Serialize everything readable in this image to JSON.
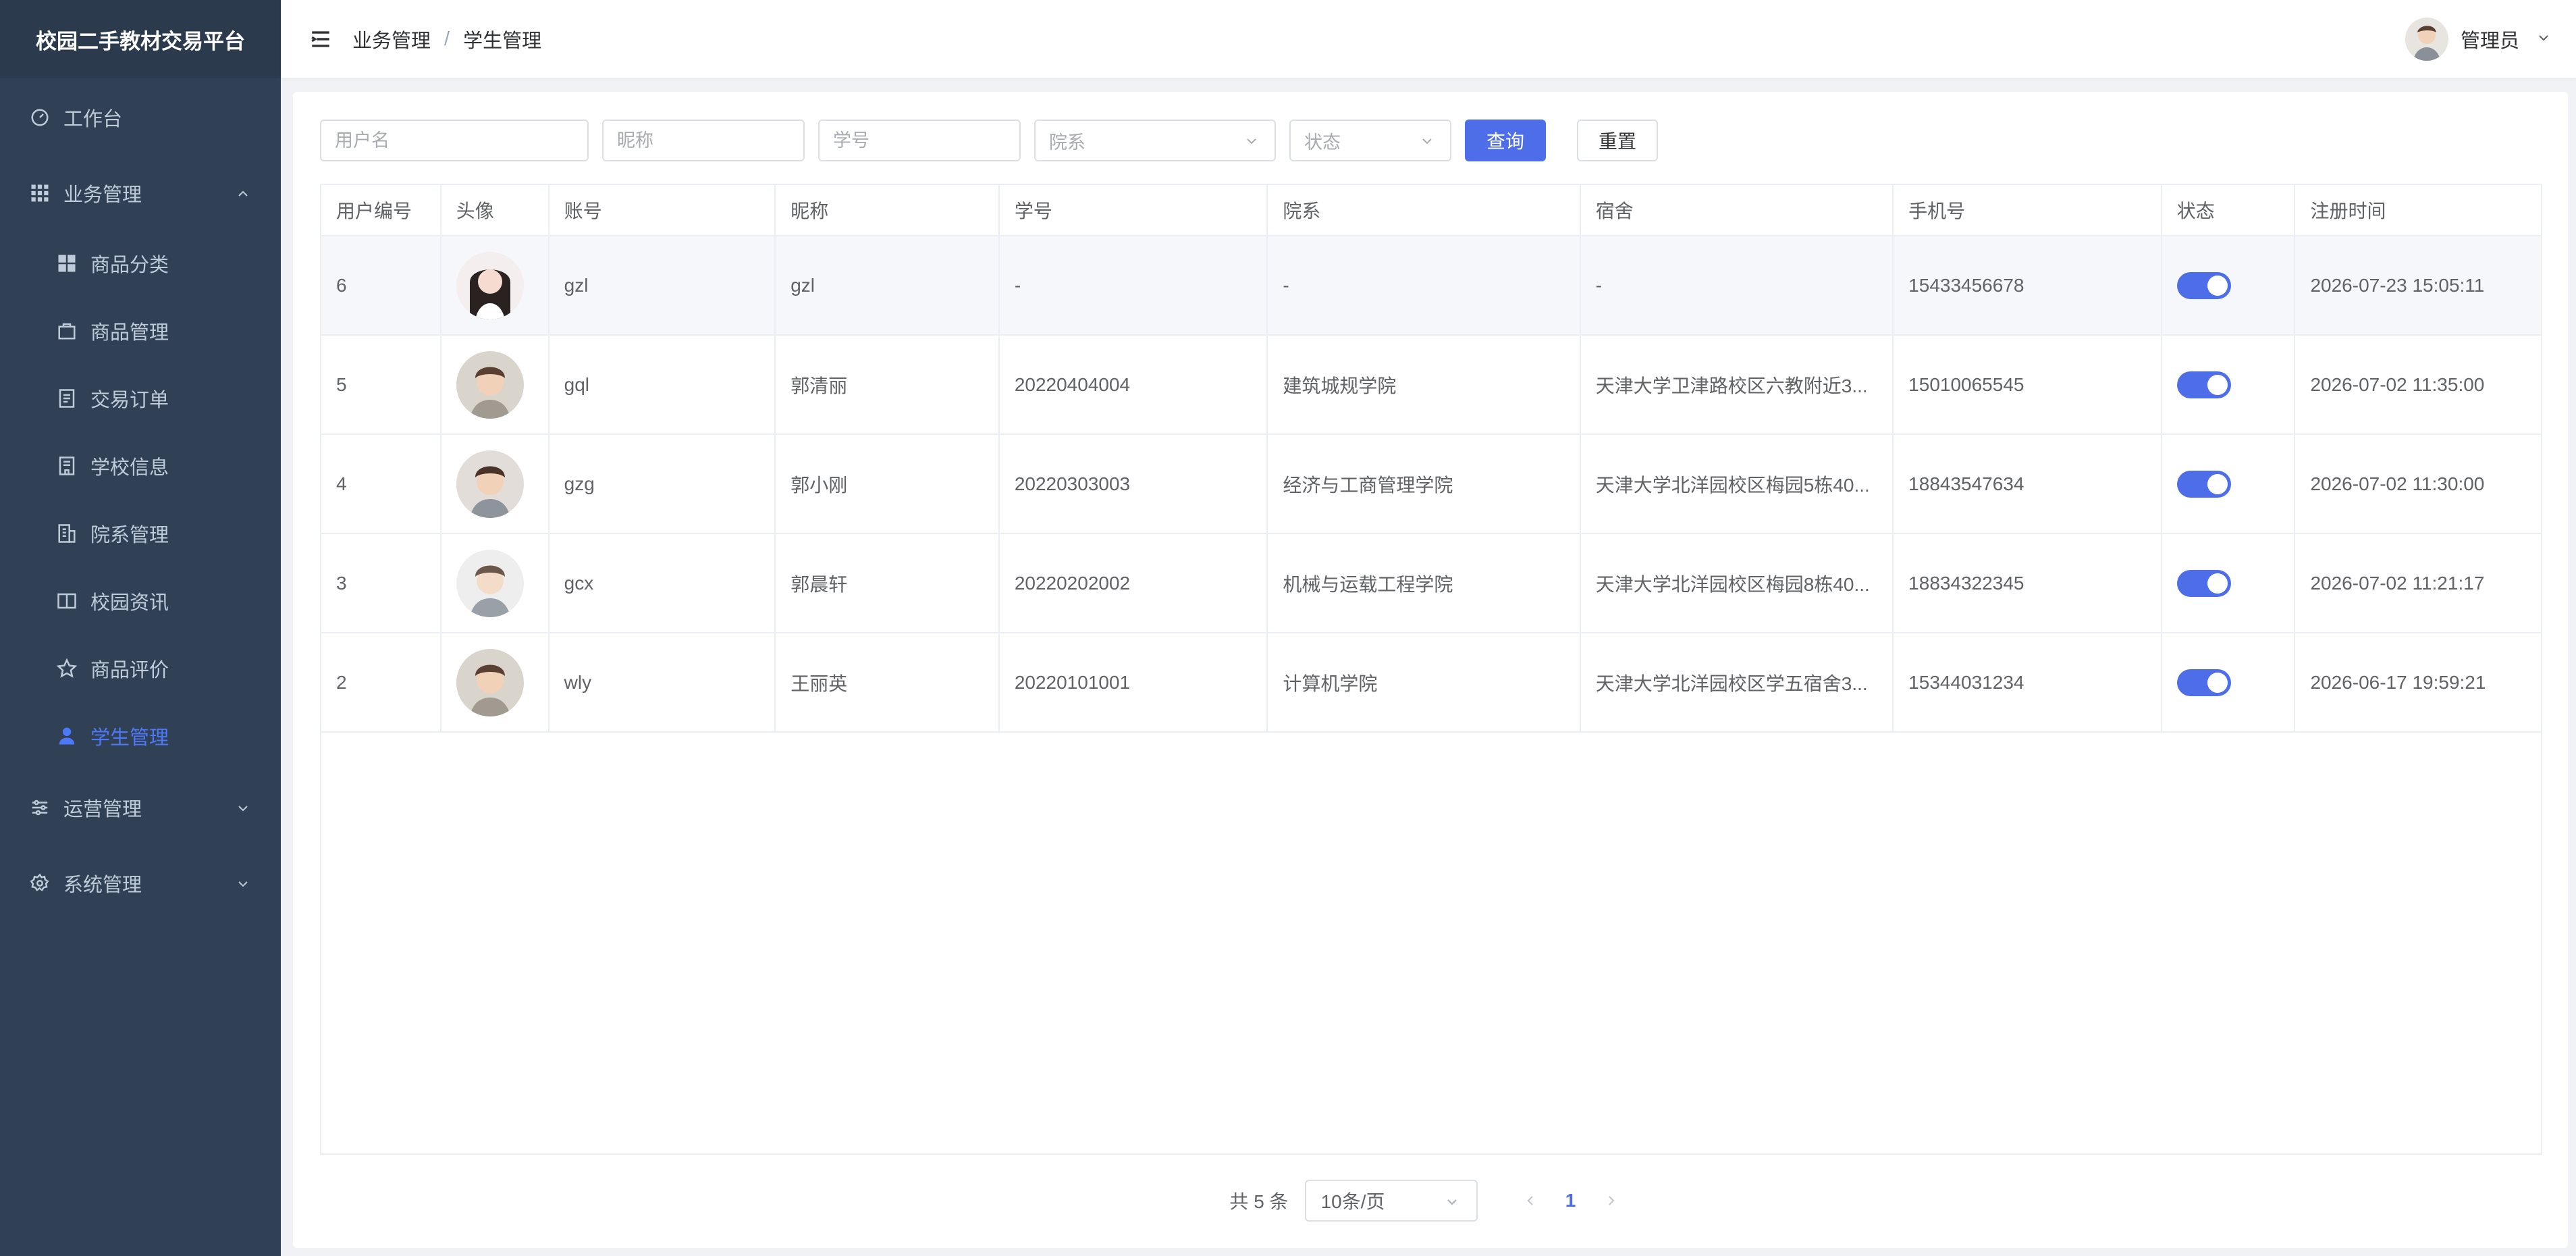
{
  "app_title": "校园二手教材交易平台",
  "sidebar": {
    "items": [
      {
        "label": "工作台",
        "icon": "dashboard-icon"
      },
      {
        "label": "业务管理",
        "icon": "grid-icon",
        "expanded": true
      },
      {
        "label": "商品分类",
        "icon": "category-icon"
      },
      {
        "label": "商品管理",
        "icon": "shopping-bag-icon"
      },
      {
        "label": "交易订单",
        "icon": "document-icon"
      },
      {
        "label": "学校信息",
        "icon": "school-icon"
      },
      {
        "label": "院系管理",
        "icon": "building-icon"
      },
      {
        "label": "校园资讯",
        "icon": "book-icon"
      },
      {
        "label": "商品评价",
        "icon": "star-icon"
      },
      {
        "label": "学生管理",
        "icon": "user-icon",
        "active": true
      },
      {
        "label": "运营管理",
        "icon": "sliders-icon"
      },
      {
        "label": "系统管理",
        "icon": "gear-icon"
      }
    ]
  },
  "header": {
    "breadcrumb": [
      "业务管理",
      "学生管理"
    ],
    "separator": "/",
    "user_name": "管理员"
  },
  "filters": {
    "username_placeholder": "用户名",
    "nickname_placeholder": "昵称",
    "student_no_placeholder": "学号",
    "department_placeholder": "院系",
    "status_placeholder": "状态",
    "query_label": "查询",
    "reset_label": "重置"
  },
  "table": {
    "columns": [
      "用户编号",
      "头像",
      "账号",
      "昵称",
      "学号",
      "院系",
      "宿舍",
      "手机号",
      "状态",
      "注册时间"
    ],
    "rows": [
      {
        "id": "6",
        "account": "gzl",
        "nickname": "gzl",
        "student_no": "-",
        "department": "-",
        "dorm": "-",
        "phone": "15433456678",
        "status": true,
        "reg_time": "2026-07-23 15:05:11"
      },
      {
        "id": "5",
        "account": "gql",
        "nickname": "郭清丽",
        "student_no": "20220404004",
        "department": "建筑城规学院",
        "dorm": "天津大学卫津路校区六教附近3...",
        "phone": "15010065545",
        "status": true,
        "reg_time": "2026-07-02 11:35:00"
      },
      {
        "id": "4",
        "account": "gzg",
        "nickname": "郭小刚",
        "student_no": "20220303003",
        "department": "经济与工商管理学院",
        "dorm": "天津大学北洋园校区梅园5栋40...",
        "phone": "18843547634",
        "status": true,
        "reg_time": "2026-07-02 11:30:00"
      },
      {
        "id": "3",
        "account": "gcx",
        "nickname": "郭晨轩",
        "student_no": "20220202002",
        "department": "机械与运载工程学院",
        "dorm": "天津大学北洋园校区梅园8栋40...",
        "phone": "18834322345",
        "status": true,
        "reg_time": "2026-07-02 11:21:17"
      },
      {
        "id": "2",
        "account": "wly",
        "nickname": "王丽英",
        "student_no": "20220101001",
        "department": "计算机学院",
        "dorm": "天津大学北洋园校区学五宿舍3...",
        "phone": "15344031234",
        "status": true,
        "reg_time": "2026-06-17 19:59:21"
      }
    ]
  },
  "pagination": {
    "total_text": "共 5 条",
    "page_size": "10条/页",
    "current_page": "1"
  },
  "colors": {
    "sidebar_bg": "#304156",
    "accent": "#4d6ee8",
    "active_menu": "#4d78f7"
  }
}
